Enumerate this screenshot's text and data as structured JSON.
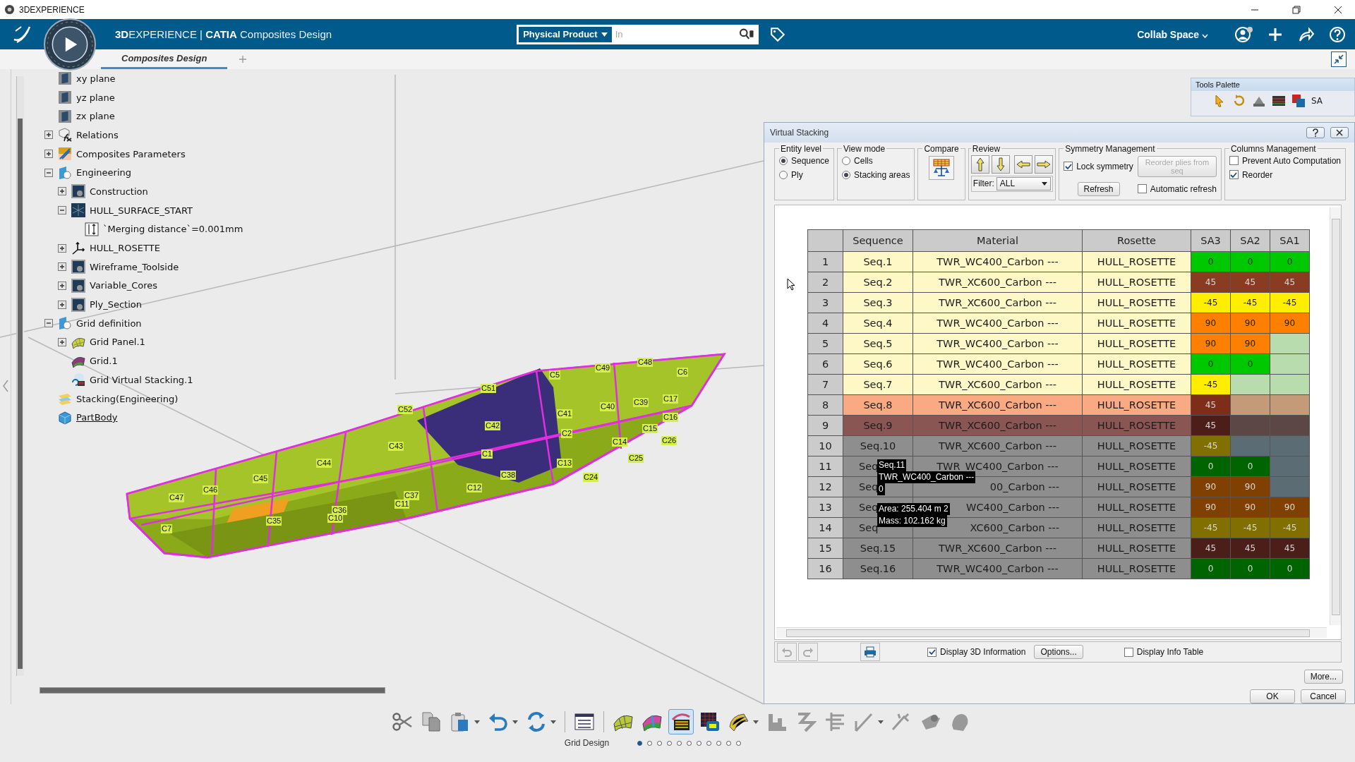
{
  "window": {
    "title": "3DEXPERIENCE"
  },
  "header": {
    "title": "**3D**EXPERIENCE | **CATIA** Composites Design",
    "search_scope": "Physical Product",
    "search_placeholder": "In",
    "collab_space": "Collab Space"
  },
  "tabs": [
    {
      "label": "Composites Design",
      "selected": true
    }
  ],
  "tree": [
    {
      "label": "xy plane",
      "kind": "plane"
    },
    {
      "label": "yz plane",
      "kind": "plane"
    },
    {
      "label": "zx plane",
      "kind": "plane"
    },
    {
      "label": "Relations",
      "kind": "relations",
      "expanded": false
    },
    {
      "label": "Composites Parameters",
      "kind": "parameters",
      "expanded": false
    },
    {
      "label": "Engineering",
      "kind": "set",
      "expanded": true,
      "children": [
        {
          "label": "Construction",
          "kind": "geoset",
          "expanded": false
        },
        {
          "label": "HULL_SURFACE_START",
          "kind": "surface",
          "expanded": true,
          "children": [
            {
              "label": "`Merging distance`=0.001mm",
              "kind": "parameter"
            }
          ]
        },
        {
          "label": "HULL_ROSETTE",
          "kind": "axis",
          "expanded": false
        },
        {
          "label": "Wireframe_Toolside",
          "kind": "geoset",
          "expanded": false
        },
        {
          "label": "Variable_Cores",
          "kind": "geoset",
          "expanded": false
        },
        {
          "label": "Ply_Section",
          "kind": "geoset",
          "expanded": false
        }
      ]
    },
    {
      "label": "Grid definition",
      "kind": "set",
      "expanded": true,
      "children": [
        {
          "label": "Grid Panel.1",
          "kind": "grid-panel",
          "expanded": false
        },
        {
          "label": "Grid.1",
          "kind": "grid"
        },
        {
          "label": "Grid Virtual Stacking.1",
          "kind": "grid-stacking"
        }
      ]
    },
    {
      "label": "Stacking(Engineering)",
      "kind": "stacking"
    },
    {
      "label": "PartBody",
      "kind": "body"
    }
  ],
  "viewport": {
    "cell_labels": [
      "C51",
      "C52",
      "C5",
      "C49",
      "C48",
      "C6",
      "C42",
      "C41",
      "C40",
      "C39",
      "C17",
      "C16",
      "C15",
      "C43",
      "C44",
      "C45",
      "C46",
      "C47",
      "C1",
      "C2",
      "C14",
      "C26",
      "C13",
      "C25",
      "C38",
      "C24",
      "C12",
      "C37",
      "C11",
      "C36",
      "C10",
      "C35",
      "C7"
    ]
  },
  "tools_palette": {
    "title": "Tools Palette",
    "tool_label": "SA"
  },
  "dialog": {
    "title": "Virtual Stacking",
    "entity_level": {
      "title": "Entity level",
      "options": [
        {
          "label": "Sequence",
          "selected": true
        },
        {
          "label": "Ply",
          "selected": false
        }
      ]
    },
    "view_mode": {
      "title": "View mode",
      "options": [
        {
          "label": "Cells",
          "selected": false
        },
        {
          "label": "Stacking areas",
          "selected": true
        }
      ]
    },
    "compare": {
      "title": "Compare"
    },
    "review": {
      "title": "Review",
      "filter_label": "Filter:",
      "filter_value": "ALL"
    },
    "symmetry": {
      "title": "Symmetry Management",
      "lock_symmetry": {
        "label": "Lock symmetry",
        "checked": true
      },
      "reorder_button": {
        "label": "Reorder plies from seq",
        "disabled": true
      },
      "refresh_button": "Refresh",
      "automatic_refresh": {
        "label": "Automatic refresh",
        "checked": false
      }
    },
    "columns_management": {
      "title": "Columns Management",
      "options": [
        {
          "label": "Prevent Auto Computation",
          "checked": false
        },
        {
          "label": "Reorder",
          "checked": true
        }
      ]
    },
    "table": {
      "columns": [
        "Sequence",
        "Material",
        "Rosette",
        "SA3",
        "SA2",
        "SA1"
      ],
      "rows": [
        {
          "number": "1",
          "sequence": "Seq.1",
          "material": "TWR_WC400_Carbon ---",
          "rosette": "HULL_ROSETTE",
          "color": "#fdf8c6",
          "sequence_covered": false,
          "material_covered": false,
          "areas": [
            {
              "value": "0",
              "color": "#00c800"
            },
            {
              "value": "0",
              "color": "#00c800"
            },
            {
              "value": "0",
              "color": "#00c800"
            }
          ]
        },
        {
          "number": "2",
          "sequence": "Seq.2",
          "material": "TWR_XC600_Carbon ---",
          "rosette": "HULL_ROSETTE",
          "color": "#fdf8c6",
          "sequence_covered": false,
          "material_covered": false,
          "areas": [
            {
              "value": "45",
              "color": "#8a3c22"
            },
            {
              "value": "45",
              "color": "#8a3c22"
            },
            {
              "value": "45",
              "color": "#8a3c22"
            }
          ]
        },
        {
          "number": "3",
          "sequence": "Seq.3",
          "material": "TWR_XC600_Carbon ---",
          "rosette": "HULL_ROSETTE",
          "color": "#fdf8c6",
          "sequence_covered": false,
          "material_covered": false,
          "areas": [
            {
              "value": "-45",
              "color": "#ffee00"
            },
            {
              "value": "-45",
              "color": "#ffee00"
            },
            {
              "value": "-45",
              "color": "#ffee00"
            }
          ]
        },
        {
          "number": "4",
          "sequence": "Seq.4",
          "material": "TWR_WC400_Carbon ---",
          "rosette": "HULL_ROSETTE",
          "color": "#fdf8c6",
          "sequence_covered": false,
          "material_covered": false,
          "areas": [
            {
              "value": "90",
              "color": "#ff8000"
            },
            {
              "value": "90",
              "color": "#ff8000"
            },
            {
              "value": "90",
              "color": "#ff8000"
            }
          ]
        },
        {
          "number": "5",
          "sequence": "Seq.5",
          "material": "TWR_WC400_Carbon ---",
          "rosette": "HULL_ROSETTE",
          "color": "#fdf8c6",
          "sequence_covered": false,
          "material_covered": false,
          "areas": [
            {
              "value": "90",
              "color": "#ff8000"
            },
            {
              "value": "90",
              "color": "#ff8000"
            },
            {
              "color": "#b8dcae"
            }
          ]
        },
        {
          "number": "6",
          "sequence": "Seq.6",
          "material": "TWR_WC400_Carbon ---",
          "rosette": "HULL_ROSETTE",
          "color": "#fdf8c6",
          "sequence_covered": false,
          "material_covered": false,
          "areas": [
            {
              "value": "0",
              "color": "#00c800"
            },
            {
              "value": "0",
              "color": "#00c800"
            },
            {
              "color": "#b8dcae"
            }
          ]
        },
        {
          "number": "7",
          "sequence": "Seq.7",
          "material": "TWR_XC600_Carbon ---",
          "rosette": "HULL_ROSETTE",
          "color": "#fdf8c6",
          "sequence_covered": false,
          "material_covered": false,
          "areas": [
            {
              "value": "-45",
              "color": "#ffee00"
            },
            {
              "color": "#b8dcae"
            },
            {
              "color": "#b8dcae"
            }
          ]
        },
        {
          "number": "8",
          "sequence": "Seq.8",
          "material": "TWR_XC600_Carbon ---",
          "rosette": "HULL_ROSETTE",
          "color": "#f9aa82",
          "sequence_covered": false,
          "material_covered": false,
          "areas": [
            {
              "value": "45",
              "color": "#7e2e18"
            },
            {
              "color": "#c49a78"
            },
            {
              "color": "#c49a78"
            }
          ]
        },
        {
          "number": "9",
          "sequence": "Seq.9",
          "material": "TWR_XC600_Carbon ---",
          "rosette": "HULL_ROSETTE",
          "color": "#8a5654",
          "sequence_covered": false,
          "material_covered": false,
          "areas": [
            {
              "value": "45",
              "color": "#4c1e1a"
            },
            {
              "color": "#5c4646"
            },
            {
              "color": "#5c4646"
            }
          ]
        },
        {
          "number": "10",
          "sequence": "Seq.10",
          "material": "TWR_XC600_Carbon ---",
          "rosette": "HULL_ROSETTE",
          "color": "#8e8e8e",
          "sequence_covered": false,
          "material_covered": false,
          "areas": [
            {
              "value": "-45",
              "color": "#817000"
            },
            {
              "color": "#5c6c74"
            },
            {
              "color": "#5c6c74"
            }
          ]
        },
        {
          "number": "11",
          "sequence": "Seq",
          "material": "TWR_WC400_Carbon ---",
          "rosette": "HULL_ROSETTE",
          "color": "#8e8e8e",
          "sequence_covered": true,
          "material_covered": false,
          "areas": [
            {
              "value": "0",
              "color": "#006400"
            },
            {
              "value": "0",
              "color": "#006400"
            },
            {
              "color": "#5c6c74"
            }
          ]
        },
        {
          "number": "12",
          "sequence": "Seq",
          "material": "00_Carbon ---",
          "rosette": "HULL_ROSETTE",
          "color": "#8e8e8e",
          "sequence_covered": true,
          "material_covered": true,
          "areas": [
            {
              "value": "90",
              "color": "#804000"
            },
            {
              "value": "90",
              "color": "#804000"
            },
            {
              "color": "#5c6c74"
            }
          ]
        },
        {
          "number": "13",
          "sequence": "Seq",
          "material": "WC400_Carbon ---",
          "rosette": "HULL_ROSETTE",
          "color": "#8e8e8e",
          "sequence_covered": true,
          "material_covered": true,
          "areas": [
            {
              "value": "90",
              "color": "#804000"
            },
            {
              "value": "90",
              "color": "#804000"
            },
            {
              "value": "90",
              "color": "#804000"
            }
          ]
        },
        {
          "number": "14",
          "sequence": "Seq",
          "material": "XC600_Carbon ---",
          "rosette": "HULL_ROSETTE",
          "color": "#8e8e8e",
          "sequence_covered": true,
          "material_covered": true,
          "areas": [
            {
              "value": "-45",
              "color": "#817000"
            },
            {
              "value": "-45",
              "color": "#817000"
            },
            {
              "value": "-45",
              "color": "#817000"
            }
          ]
        },
        {
          "number": "15",
          "sequence": "Seq.15",
          "material": "TWR_XC600_Carbon ---",
          "rosette": "HULL_ROSETTE",
          "color": "#8e8e8e",
          "sequence_covered": false,
          "material_covered": false,
          "areas": [
            {
              "value": "45",
              "color": "#4c1e1a"
            },
            {
              "value": "45",
              "color": "#4c1e1a"
            },
            {
              "value": "45",
              "color": "#4c1e1a"
            }
          ]
        },
        {
          "number": "16",
          "sequence": "Seq.16",
          "material": "TWR_WC400_Carbon ---",
          "rosette": "HULL_ROSETTE",
          "color": "#8e8e8e",
          "sequence_covered": false,
          "material_covered": false,
          "areas": [
            {
              "value": "0",
              "color": "#006400"
            },
            {
              "value": "0",
              "color": "#006400"
            },
            {
              "value": "0",
              "color": "#006400"
            }
          ]
        }
      ]
    },
    "tooltip": {
      "lines": [
        "Seq.11",
        "TWR_WC400_Carbon ---",
        "0"
      ],
      "details": [
        "Area: 255.404 m 2",
        "Mass: 102.162 kg"
      ]
    },
    "footer": {
      "display_3d": {
        "label": "Display 3D Information",
        "checked": true
      },
      "options_button": "Options...",
      "display_info_table": {
        "label": "Display Info Table",
        "checked": false
      },
      "more_button": "More...",
      "ok_button": "OK",
      "cancel_button": "Cancel"
    }
  },
  "toolbar": {
    "tools": [
      {
        "kind": "cut",
        "caret": false,
        "selected": false
      },
      {
        "kind": "copy",
        "caret": false,
        "selected": false
      },
      {
        "kind": "paste",
        "caret": true,
        "selected": false
      },
      {
        "kind": "undo",
        "caret": true,
        "selected": false
      },
      {
        "kind": "update",
        "caret": true,
        "selected": false
      },
      {
        "kind": "list",
        "caret": false,
        "selected": false
      },
      {
        "kind": "grid-panel",
        "caret": false,
        "selected": false
      },
      {
        "kind": "grid",
        "caret": false,
        "selected": false
      },
      {
        "kind": "grid-stacking",
        "caret": false,
        "selected": true
      },
      {
        "kind": "grid-table",
        "caret": false,
        "selected": false
      },
      {
        "kind": "shell",
        "caret": true,
        "selected": false
      },
      {
        "kind": "step",
        "caret": false,
        "selected": false
      },
      {
        "kind": "zigzag",
        "caret": false,
        "selected": false
      },
      {
        "kind": "comb",
        "caret": false,
        "selected": false
      },
      {
        "kind": "angle",
        "caret": true,
        "selected": false
      },
      {
        "kind": "wand",
        "caret": false,
        "selected": false
      },
      {
        "kind": "flag",
        "caret": false,
        "selected": false
      },
      {
        "kind": "cap",
        "caret": false,
        "selected": false
      }
    ],
    "label": "Grid Design",
    "pages": [
      {
        "selected": true
      },
      {
        "selected": false
      },
      {
        "selected": false
      },
      {
        "selected": false
      },
      {
        "selected": false
      },
      {
        "selected": false
      },
      {
        "selected": false
      },
      {
        "selected": false
      },
      {
        "selected": false
      },
      {
        "selected": false
      },
      {
        "selected": false
      }
    ]
  }
}
